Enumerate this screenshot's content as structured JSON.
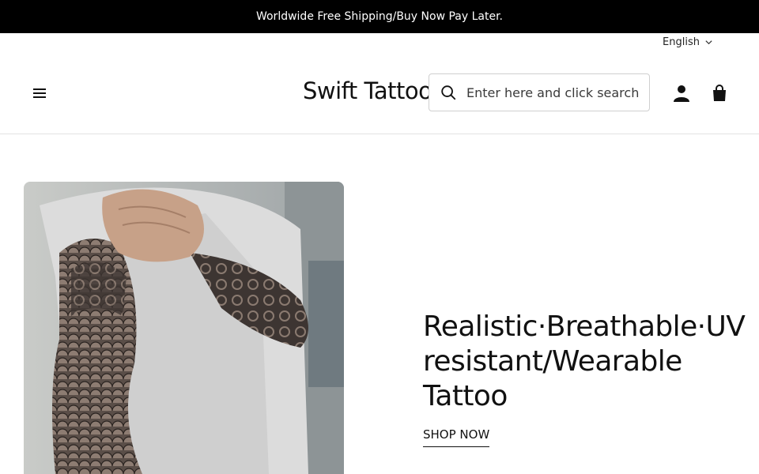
{
  "announcement": {
    "text": "Worldwide Free Shipping/Buy Now Pay Later."
  },
  "language": {
    "selected": "English",
    "icon": "chevron-down-icon"
  },
  "header": {
    "logo": "Swift Tattoo",
    "menu_icon": "hamburger-menu-icon",
    "search": {
      "placeholder": "Enter here and click search",
      "value": "",
      "icon": "search-icon"
    },
    "account_icon": "user-icon",
    "cart_icon": "shopping-bag-icon"
  },
  "hero": {
    "title": "Realistic·Breathable·UV resistant/Wearable Tattoo",
    "cta_label": "SHOP NOW",
    "image_subject": "person wearing tattoo sleeve"
  },
  "colors": {
    "announcement_bg": "#000000",
    "text": "#111111",
    "border": "#e3e3e3"
  }
}
